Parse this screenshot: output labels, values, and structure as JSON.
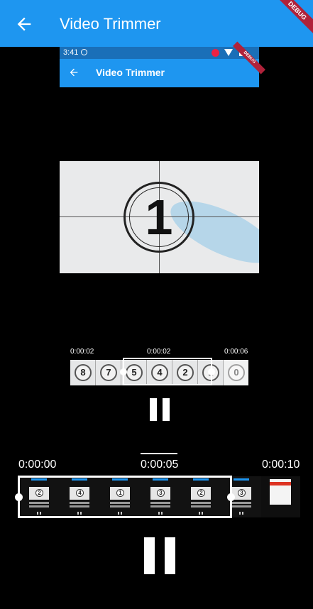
{
  "app_bar": {
    "title": "Video Trimmer",
    "debug_banner": "DEBUG"
  },
  "inner_screen": {
    "status_time": "3:41",
    "app_bar_title": "Video Trimmer",
    "debug_banner": "DEBUG"
  },
  "video": {
    "countdown_digit": "1"
  },
  "small_trimmer": {
    "start_time": "0:00:02",
    "current_time": "0:00:02",
    "end_time": "0:00:06",
    "frames": [
      "8",
      "7",
      "5",
      "4",
      "2",
      "1",
      "0"
    ]
  },
  "large_trimmer": {
    "start_time": "0:00:00",
    "current_time": "0:00:05",
    "end_time": "0:00:10",
    "frames": [
      "2",
      "4",
      "1",
      "3",
      "2",
      "3"
    ]
  },
  "colors": {
    "app_bar": "#1e96f0",
    "background": "#000000",
    "debug": "#b0223a"
  },
  "icons": {
    "back": "arrow-left-icon",
    "pause": "pause-icon"
  }
}
